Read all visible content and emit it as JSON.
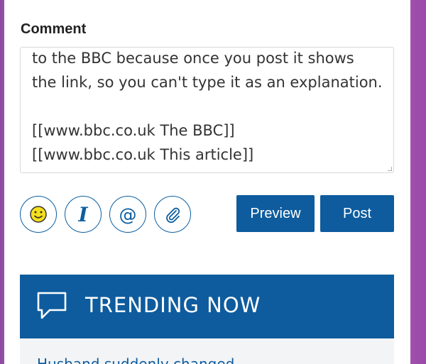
{
  "form": {
    "label": "Comment",
    "lines": [
      "to the BBC because once you post it shows",
      "the link, so you can't type it as an explanation.",
      "",
      "[[www.bbc.co.uk The BBC]]",
      "[[www.bbc.co.uk This article]]"
    ],
    "toolbar": {
      "smiley": "smiley-icon",
      "italic": "I",
      "mention": "@",
      "attach": "paperclip-icon"
    },
    "preview_label": "Preview",
    "post_label": "Post"
  },
  "trending": {
    "title": "TRENDING NOW",
    "first_item": "Husband suddenly changed"
  },
  "colors": {
    "accent": "#0e5c9e",
    "side": "#9550a8"
  }
}
